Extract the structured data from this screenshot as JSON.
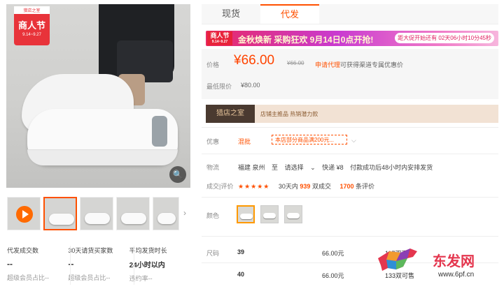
{
  "gallery": {
    "badge_top": "猎店之室",
    "badge_title": "商人节",
    "badge_date": "9.14~9.27",
    "zoom_icon": "magnifier-icon",
    "next_icon": "chevron-right-icon"
  },
  "stats": [
    {
      "title": "代发成交数",
      "value": "--",
      "sub": "超级会员占比--"
    },
    {
      "title": "30天请货买家数",
      "value": "--",
      "sub": "超级会员占比--"
    },
    {
      "title": "平均发货时长",
      "value": "24小时以内",
      "sub": "违约率--"
    }
  ],
  "tabs": [
    {
      "label": "现货"
    },
    {
      "label": "代发"
    }
  ],
  "banner": {
    "badge": "商人节",
    "badge_date": "9.14~9.27",
    "slogan": "金秋焕新 采购狂欢 9月14日0点开抢!",
    "countdown": "距大促开始还有 02天06小时10分45秒"
  },
  "price": {
    "label": "价格",
    "current": "¥66.00",
    "original": "¥66.00",
    "agent_link": "申请代理",
    "agent_text": "可获得渠道专属优惠价",
    "min_label": "最低限价",
    "min_value": "¥80.00"
  },
  "store": {
    "logo": "猎店之室",
    "text": "店铺主推品  热销潜力款"
  },
  "promo": {
    "label": "优惠",
    "tag": "混批",
    "coupon": "本店部分商品满200元...",
    "chevron": "chevron-down-icon"
  },
  "logistics": {
    "label": "物流",
    "from": "福建 泉州",
    "to_word": "至",
    "select": "请选择",
    "express": "快递 ¥8",
    "note": "付款成功后48小时内安排发货"
  },
  "rating": {
    "label": "成交|评价",
    "stars": "★★★★★",
    "sold_prefix": "30天内",
    "sold_count": "939",
    "sold_suffix": "双成交",
    "review_count": "1700",
    "review_suffix": "条评价"
  },
  "color": {
    "label": "颜色"
  },
  "sizes": {
    "label": "尺码",
    "rows": [
      {
        "size": "39",
        "price": "66.00元",
        "stock": "117双可售"
      },
      {
        "size": "40",
        "price": "66.00元",
        "stock": "133双可售"
      }
    ]
  },
  "watermark": {
    "cn": "东发网",
    "url": "www.6pf.cn"
  },
  "colors": {
    "accent": "#ff5000",
    "price": "#ff4400",
    "banner_start": "#e82a64",
    "banner_end": "#f7b6dd"
  }
}
